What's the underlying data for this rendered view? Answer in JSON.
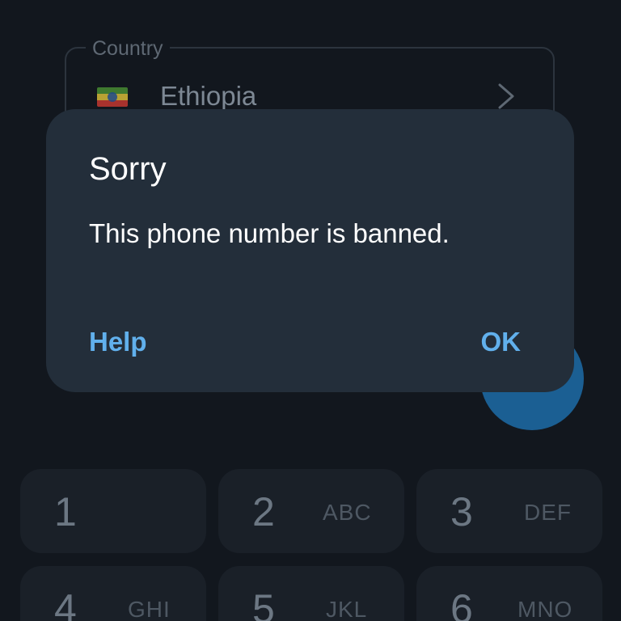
{
  "country_field": {
    "label": "Country",
    "value": "Ethiopia",
    "flag_icon": "ethiopia-flag-icon",
    "chevron_icon": "chevron-right-icon"
  },
  "keypad": {
    "keys": [
      {
        "digit": "1",
        "letters": ""
      },
      {
        "digit": "2",
        "letters": "ABC"
      },
      {
        "digit": "3",
        "letters": "DEF"
      },
      {
        "digit": "4",
        "letters": "GHI"
      },
      {
        "digit": "5",
        "letters": "JKL"
      },
      {
        "digit": "6",
        "letters": "MNO"
      }
    ]
  },
  "dialog": {
    "title": "Sorry",
    "message": "This phone number is banned.",
    "help_label": "Help",
    "ok_label": "OK"
  },
  "colors": {
    "background": "#12171e",
    "dialog_bg": "#232e3a",
    "accent": "#61b0ec",
    "fab": "#1b5f93"
  }
}
